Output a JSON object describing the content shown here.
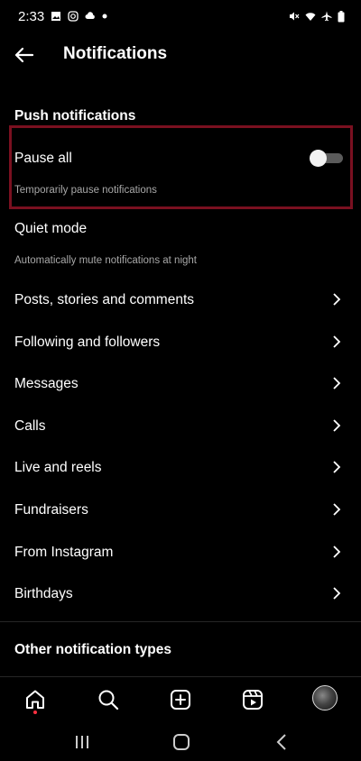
{
  "status_bar": {
    "time": "2:33",
    "left_icons": [
      "gallery-icon",
      "instagram-icon",
      "cloud-icon",
      "dot-icon"
    ],
    "right_icons": [
      "mute-icon",
      "wifi-icon",
      "airplane-icon",
      "battery-icon"
    ]
  },
  "header": {
    "title": "Notifications"
  },
  "push_section": {
    "title": "Push notifications"
  },
  "pause_all": {
    "label": "Pause all",
    "description": "Temporarily pause notifications",
    "enabled": false,
    "highlight_color": "#7a1020"
  },
  "quiet_mode": {
    "label": "Quiet mode",
    "description": "Automatically mute notifications at night"
  },
  "menu_items": [
    "Posts, stories and comments",
    "Following and followers",
    "Messages",
    "Calls",
    "Live and reels",
    "Fundraisers",
    "From Instagram",
    "Birthdays"
  ],
  "other_section": {
    "title": "Other notification types"
  },
  "tab_bar": [
    "home-icon",
    "search-icon",
    "create-icon",
    "reels-icon",
    "profile-avatar"
  ],
  "nav_bar": [
    "recent-apps-icon",
    "home-button-icon",
    "back-nav-icon"
  ],
  "colors": {
    "background": "#000000",
    "text": "#ffffff",
    "secondary_text": "#a8a8a8",
    "notification_dot": "#ff3040"
  }
}
